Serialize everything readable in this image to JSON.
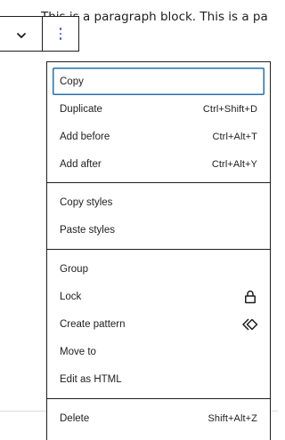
{
  "background": {
    "paragraph_visible_text": "This is a paragraph block.  This is a pa"
  },
  "toolbar": {
    "chevron_icon": "chevron-down-icon",
    "options_icon": "kebab-vertical-icon",
    "accent_color": "#3858e9"
  },
  "menu": {
    "groups": [
      {
        "items": [
          {
            "label": "Copy",
            "shortcut": "",
            "focused": true
          },
          {
            "label": "Duplicate",
            "shortcut": "Ctrl+Shift+D"
          },
          {
            "label": "Add before",
            "shortcut": "Ctrl+Alt+T"
          },
          {
            "label": "Add after",
            "shortcut": "Ctrl+Alt+Y"
          }
        ]
      },
      {
        "items": [
          {
            "label": "Copy styles",
            "shortcut": ""
          },
          {
            "label": "Paste styles",
            "shortcut": ""
          }
        ]
      },
      {
        "items": [
          {
            "label": "Group",
            "shortcut": ""
          },
          {
            "label": "Lock",
            "icon": "lock-icon"
          },
          {
            "label": "Create pattern",
            "icon": "pattern-icon"
          },
          {
            "label": "Move to",
            "shortcut": ""
          },
          {
            "label": "Edit as HTML",
            "shortcut": ""
          }
        ]
      },
      {
        "items": [
          {
            "label": "Delete",
            "shortcut": "Shift+Alt+Z"
          }
        ]
      }
    ],
    "focus_color": "#2271b1"
  }
}
